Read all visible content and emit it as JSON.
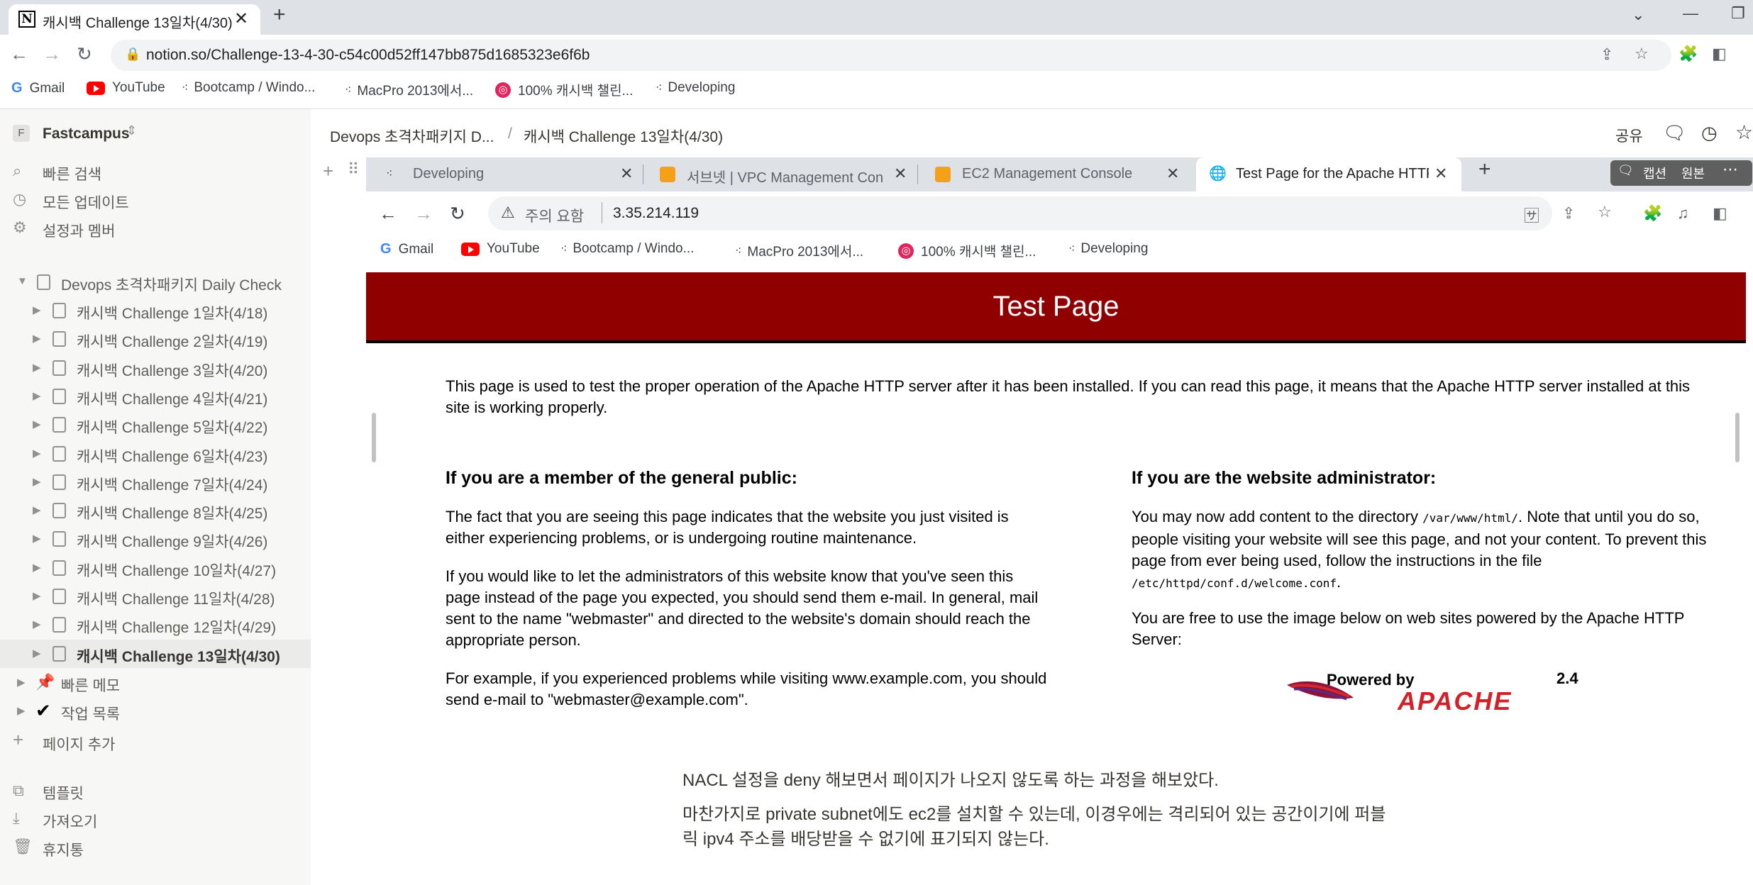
{
  "outer_browser": {
    "tab_title": "캐시백 Challenge 13일차(4/30)",
    "url": "notion.so/Challenge-13-4-30-c54c00d52ff147bb875d1685323e6f6b",
    "bookmarks": [
      "Gmail",
      "YouTube",
      "Bootcamp / Windo...",
      "MacPro 2013에서...",
      "100% 캐시백 챌린...",
      "Developing"
    ]
  },
  "sidebar": {
    "workspace": "Fastcampus",
    "quick_items": [
      "빠른 검색",
      "모든 업데이트",
      "설정과 멤버"
    ],
    "parent_page": "Devops 초격차패키지 Daily Check",
    "children": [
      "캐시백 Challenge 1일차(4/18)",
      "캐시백 Challenge 2일차(4/19)",
      "캐시백 Challenge 3일차(4/20)",
      "캐시백 Challenge 4일차(4/21)",
      "캐시백 Challenge 5일차(4/22)",
      "캐시백 Challenge 6일차(4/23)",
      "캐시백 Challenge 7일차(4/24)",
      "캐시백 Challenge 8일차(4/25)",
      "캐시백 Challenge 9일차(4/26)",
      "캐시백 Challenge 10일차(4/27)",
      "캐시백 Challenge 11일차(4/28)",
      "캐시백 Challenge 12일차(4/29)",
      "캐시백 Challenge 13일차(4/30)"
    ],
    "quick_memo": "빠른 메모",
    "task_list": "작업 목록",
    "add_page": "페이지 추가",
    "templates": "템플릿",
    "import": "가져오기",
    "trash": "휴지통"
  },
  "topbar": {
    "breadcrumb_parent": "Devops 초격차패키지 D...",
    "breadcrumb_sep": "/",
    "breadcrumb_current": "캐시백 Challenge 13일차(4/30)",
    "share": "공유",
    "caption_btn": "캡션",
    "original_btn": "원본"
  },
  "inner_browser": {
    "tabs": [
      "Developing",
      "서브넷 | VPC Management Con",
      "EC2 Management Console",
      "Test Page for the Apache HTTP"
    ],
    "security_warning": "주의 요함",
    "address": "3.35.214.119",
    "bookmarks": [
      "Gmail",
      "YouTube",
      "Bootcamp / Windo...",
      "MacPro 2013에서...",
      "100% 캐시백 챌린...",
      "Developing"
    ]
  },
  "apache_page": {
    "banner_title": "Test Page",
    "intro": "This page is used to test the proper operation of the Apache HTTP server after it has been installed. If you can read this page, it means that the Apache HTTP server installed at this site is working properly.",
    "left_heading": "If you are a member of the general public:",
    "left_p1": "The fact that you are seeing this page indicates that the website you just visited is either experiencing problems, or is undergoing routine maintenance.",
    "left_p2": "If you would like to let the administrators of this website know that you've seen this page instead of the page you expected, you should send them e-mail. In general, mail sent to the name \"webmaster\" and directed to the website's domain should reach the appropriate person.",
    "left_p3": "For example, if you experienced problems while visiting www.example.com, you should send e-mail to \"webmaster@example.com\".",
    "right_heading": "If you are the website administrator:",
    "right_p1_a": "You may now add content to the directory ",
    "right_p1_code1": "/var/www/html/",
    "right_p1_b": ". Note that until you do so, people visiting your website will see this page, and not your content. To prevent this page from ever being used, follow the instructions in the file ",
    "right_p1_code2": "/etc/httpd/conf.d/welcome.conf",
    "right_p1_c": ".",
    "right_p2": "You are free to use the image below on web sites powered by the Apache HTTP Server:",
    "logo_powered": "Powered by",
    "logo_version": "2.4",
    "logo_name": "APACHE"
  },
  "notes": {
    "line1": "NACL 설정을 deny 해보면서 페이지가 나오지 않도록 하는 과정을 해보았다.",
    "line2a": "마찬가지로 private subnet에도 ec2를 설치할 수 있는데, 이경우에는 격리되어 있는 공간이기에 퍼블",
    "line2b": "릭 ipv4 주소를 배당받을 수 없기에 표기되지 않는다."
  },
  "colors": {
    "banner": "#900000",
    "tabbar": "#dee1e6",
    "sidebar": "#f7f7f5"
  }
}
